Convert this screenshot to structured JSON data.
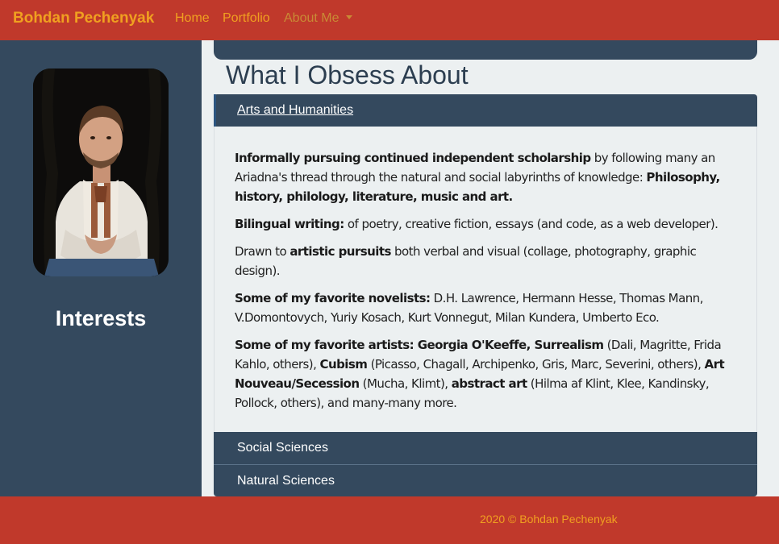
{
  "navbar": {
    "brand": "Bohdan Pechenyak",
    "links": [
      "Home",
      "Portfolio",
      "About Me"
    ],
    "brand_color": "#f0a020",
    "bg_color": "#c0392b"
  },
  "sidebar": {
    "title": "Interests",
    "bg_color": "#34495e"
  },
  "main": {
    "title": "What I Obsess About",
    "accordion": {
      "sections": [
        "Arts and Humanities",
        "Social Sciences",
        "Natural Sciences"
      ],
      "open": {
        "p1": {
          "b1": "Informally pursuing continued independent scholarship",
          "t1": " by following many an Ariadna's thread through the natural and social labyrinths of knowledge: ",
          "b2": "Philosophy, history, philology, literature, music and art."
        },
        "p2": {
          "b1": "Bilingual writing:",
          "t1": " of poetry, creative fiction, essays (and code, as a web developer)."
        },
        "p3": {
          "t1": "Drawn to ",
          "b1": "artistic pursuits",
          "t2": " both verbal and visual (collage, photography, graphic design)."
        },
        "p4": {
          "b1": "Some of my favorite novelists:",
          "t1": " D.H. Lawrence, Hermann Hesse, Thomas Mann, V.Domontovych, Yuriy Kosach, Kurt Vonnegut, Milan Kundera, Umberto Eco."
        },
        "p5": {
          "b1": "Some of my favorite artists: Georgia O'Keeffe, Surrealism",
          "t1": " (Dali, Magritte, Frida Kahlo, others), ",
          "b2": "Cubism",
          "t2": " (Picasso, Chagall, Archipenko, Gris, Marc, Severini, others), ",
          "b3": "Art Nouveau/Secession",
          "t3": " (Mucha, Klimt), ",
          "b4": "abstract art",
          "t4": " (Hilma af Klint, Klee, Kandinsky, Pollock, others), and many-many more."
        }
      }
    }
  },
  "footer": {
    "text": "2020 © Bohdan Pechenyak"
  }
}
